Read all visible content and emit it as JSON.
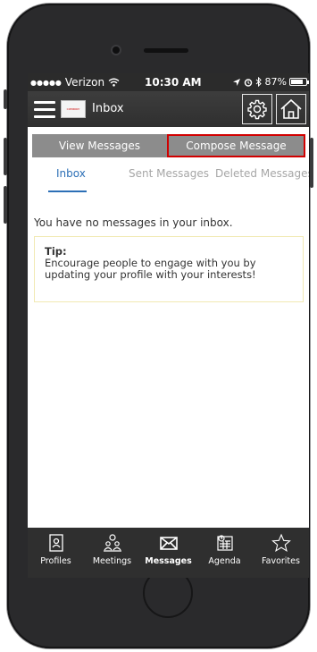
{
  "status_bar": {
    "carrier": "Verizon",
    "time": "10:30 AM",
    "battery": "87%"
  },
  "app_bar": {
    "title": "Inbox",
    "logo_text": "COMPANY"
  },
  "segment": {
    "view_label": "View Messages",
    "compose_label": "Compose Message"
  },
  "tabs": [
    {
      "label": "Inbox",
      "active": true
    },
    {
      "label": "Sent Messages",
      "active": false
    },
    {
      "label": "Deleted Messages",
      "active": false
    }
  ],
  "content": {
    "empty_message": "You have no messages in your inbox.",
    "tip_title": "Tip:",
    "tip_text": "Encourage people to engage with you by updating your profile with your interests!"
  },
  "tab_bar": [
    {
      "label": "Profiles",
      "icon": "profile-icon",
      "active": false
    },
    {
      "label": "Meetings",
      "icon": "meetings-icon",
      "active": false
    },
    {
      "label": "Messages",
      "icon": "envelope-icon",
      "active": true
    },
    {
      "label": "Agenda",
      "icon": "calendar-icon",
      "active": false
    },
    {
      "label": "Favorites",
      "icon": "star-icon",
      "active": false
    }
  ],
  "colors": {
    "accent_blue": "#2c6fb6",
    "compose_border": "#d10000",
    "segment_gray": "#8c8c8c",
    "bar_dark": "#2f2f2f"
  }
}
